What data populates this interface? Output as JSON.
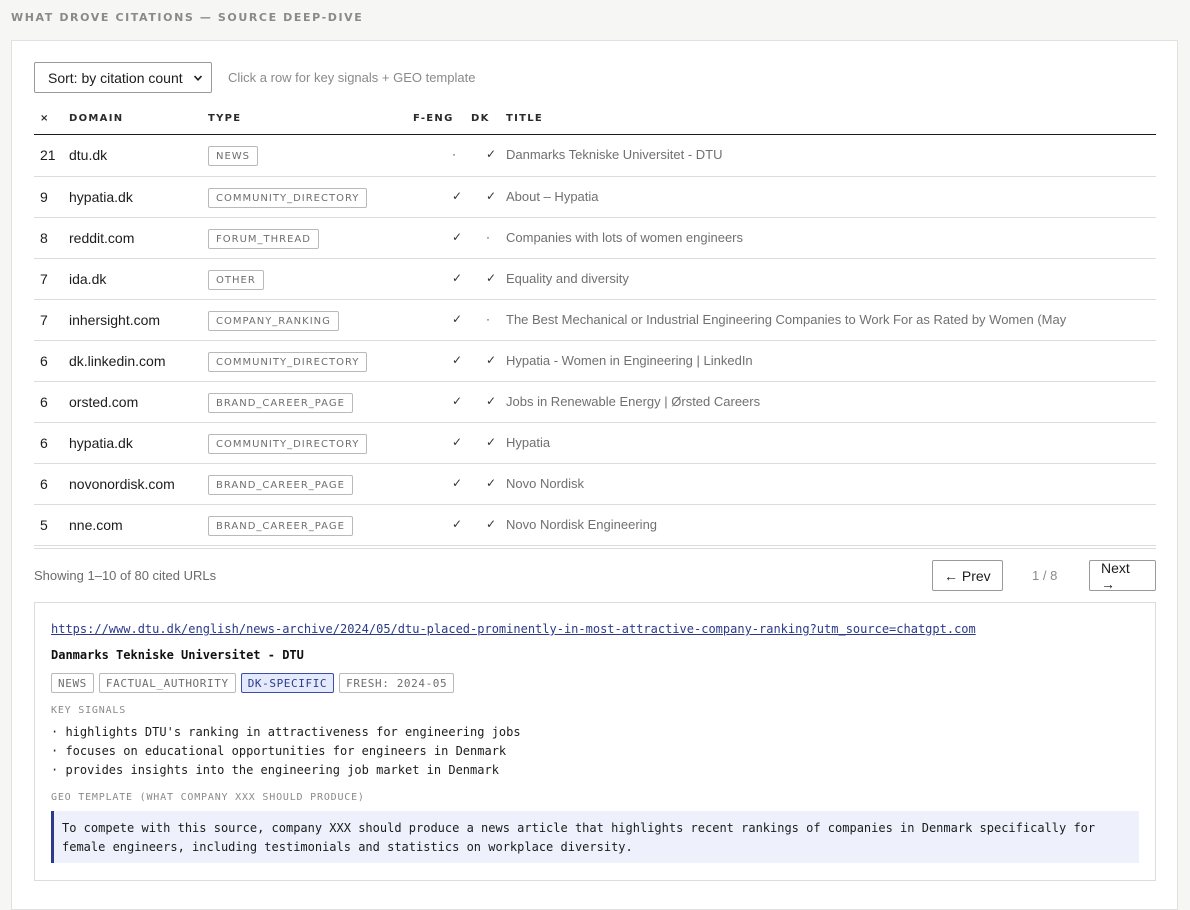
{
  "section_heading": "WHAT DROVE CITATIONS — SOURCE DEEP-DIVE",
  "toolbar": {
    "sort_label": "Sort: by citation count",
    "hint": "Click a row for key signals + GEO template"
  },
  "table": {
    "headers": {
      "count": "×",
      "domain": "DOMAIN",
      "type": "TYPE",
      "feng": "F-ENG",
      "dk": "DK",
      "title": "TITLE"
    },
    "rows": [
      {
        "count": "21",
        "domain": "dtu.dk",
        "type": "NEWS",
        "feng": "·",
        "dk": "✓",
        "title": "Danmarks Tekniske Universitet - DTU"
      },
      {
        "count": "9",
        "domain": "hypatia.dk",
        "type": "COMMUNITY_DIRECTORY",
        "feng": "✓",
        "dk": "✓",
        "title": "About – Hypatia"
      },
      {
        "count": "8",
        "domain": "reddit.com",
        "type": "FORUM_THREAD",
        "feng": "✓",
        "dk": "·",
        "title": "Companies with lots of women engineers"
      },
      {
        "count": "7",
        "domain": "ida.dk",
        "type": "OTHER",
        "feng": "✓",
        "dk": "✓",
        "title": "Equality and diversity"
      },
      {
        "count": "7",
        "domain": "inhersight.com",
        "type": "COMPANY_RANKING",
        "feng": "✓",
        "dk": "·",
        "title": "The Best Mechanical or Industrial Engineering Companies to Work For as Rated by Women (May"
      },
      {
        "count": "6",
        "domain": "dk.linkedin.com",
        "type": "COMMUNITY_DIRECTORY",
        "feng": "✓",
        "dk": "✓",
        "title": "Hypatia - Women in Engineering | LinkedIn"
      },
      {
        "count": "6",
        "domain": "orsted.com",
        "type": "BRAND_CAREER_PAGE",
        "feng": "✓",
        "dk": "✓",
        "title": "Jobs in Renewable Energy | Ørsted Careers"
      },
      {
        "count": "6",
        "domain": "hypatia.dk",
        "type": "COMMUNITY_DIRECTORY",
        "feng": "✓",
        "dk": "✓",
        "title": "Hypatia"
      },
      {
        "count": "6",
        "domain": "novonordisk.com",
        "type": "BRAND_CAREER_PAGE",
        "feng": "✓",
        "dk": "✓",
        "title": "Novo Nordisk"
      },
      {
        "count": "5",
        "domain": "nne.com",
        "type": "BRAND_CAREER_PAGE",
        "feng": "✓",
        "dk": "✓",
        "title": "Novo Nordisk Engineering"
      }
    ]
  },
  "pager": {
    "showing": "Showing 1–10 of 80 cited URLs",
    "prev": "← Prev",
    "page": "1 / 8",
    "next": "Next →"
  },
  "detail": {
    "url": "https://www.dtu.dk/english/news-archive/2024/05/dtu-placed-prominently-in-most-attractive-company-ranking?utm_source=chatgpt.com",
    "title": "Danmarks Tekniske Universitet - DTU",
    "tags": [
      {
        "label": "NEWS",
        "highlight": false
      },
      {
        "label": "FACTUAL_AUTHORITY",
        "highlight": false
      },
      {
        "label": "DK-SPECIFIC",
        "highlight": true
      },
      {
        "label": "FRESH: 2024-05",
        "highlight": false
      }
    ],
    "signals_label": "KEY SIGNALS",
    "signals": [
      "· highlights DTU's ranking in attractiveness for engineering jobs",
      "· focuses on educational opportunities for engineers in Denmark",
      "· provides insights into the engineering job market in Denmark"
    ],
    "geo_label": "GEO TEMPLATE (WHAT COMPANY XXX SHOULD PRODUCE)",
    "geo_text": "To compete with this source, company XXX should produce a news article that highlights recent rankings of companies in Denmark specifically for female engineers, including testimonials and statistics on workplace diversity."
  },
  "colors": {
    "accent": "#2b3a8a",
    "highlight_bg": "#e4e9fb",
    "geo_bg": "#eef1fb"
  }
}
